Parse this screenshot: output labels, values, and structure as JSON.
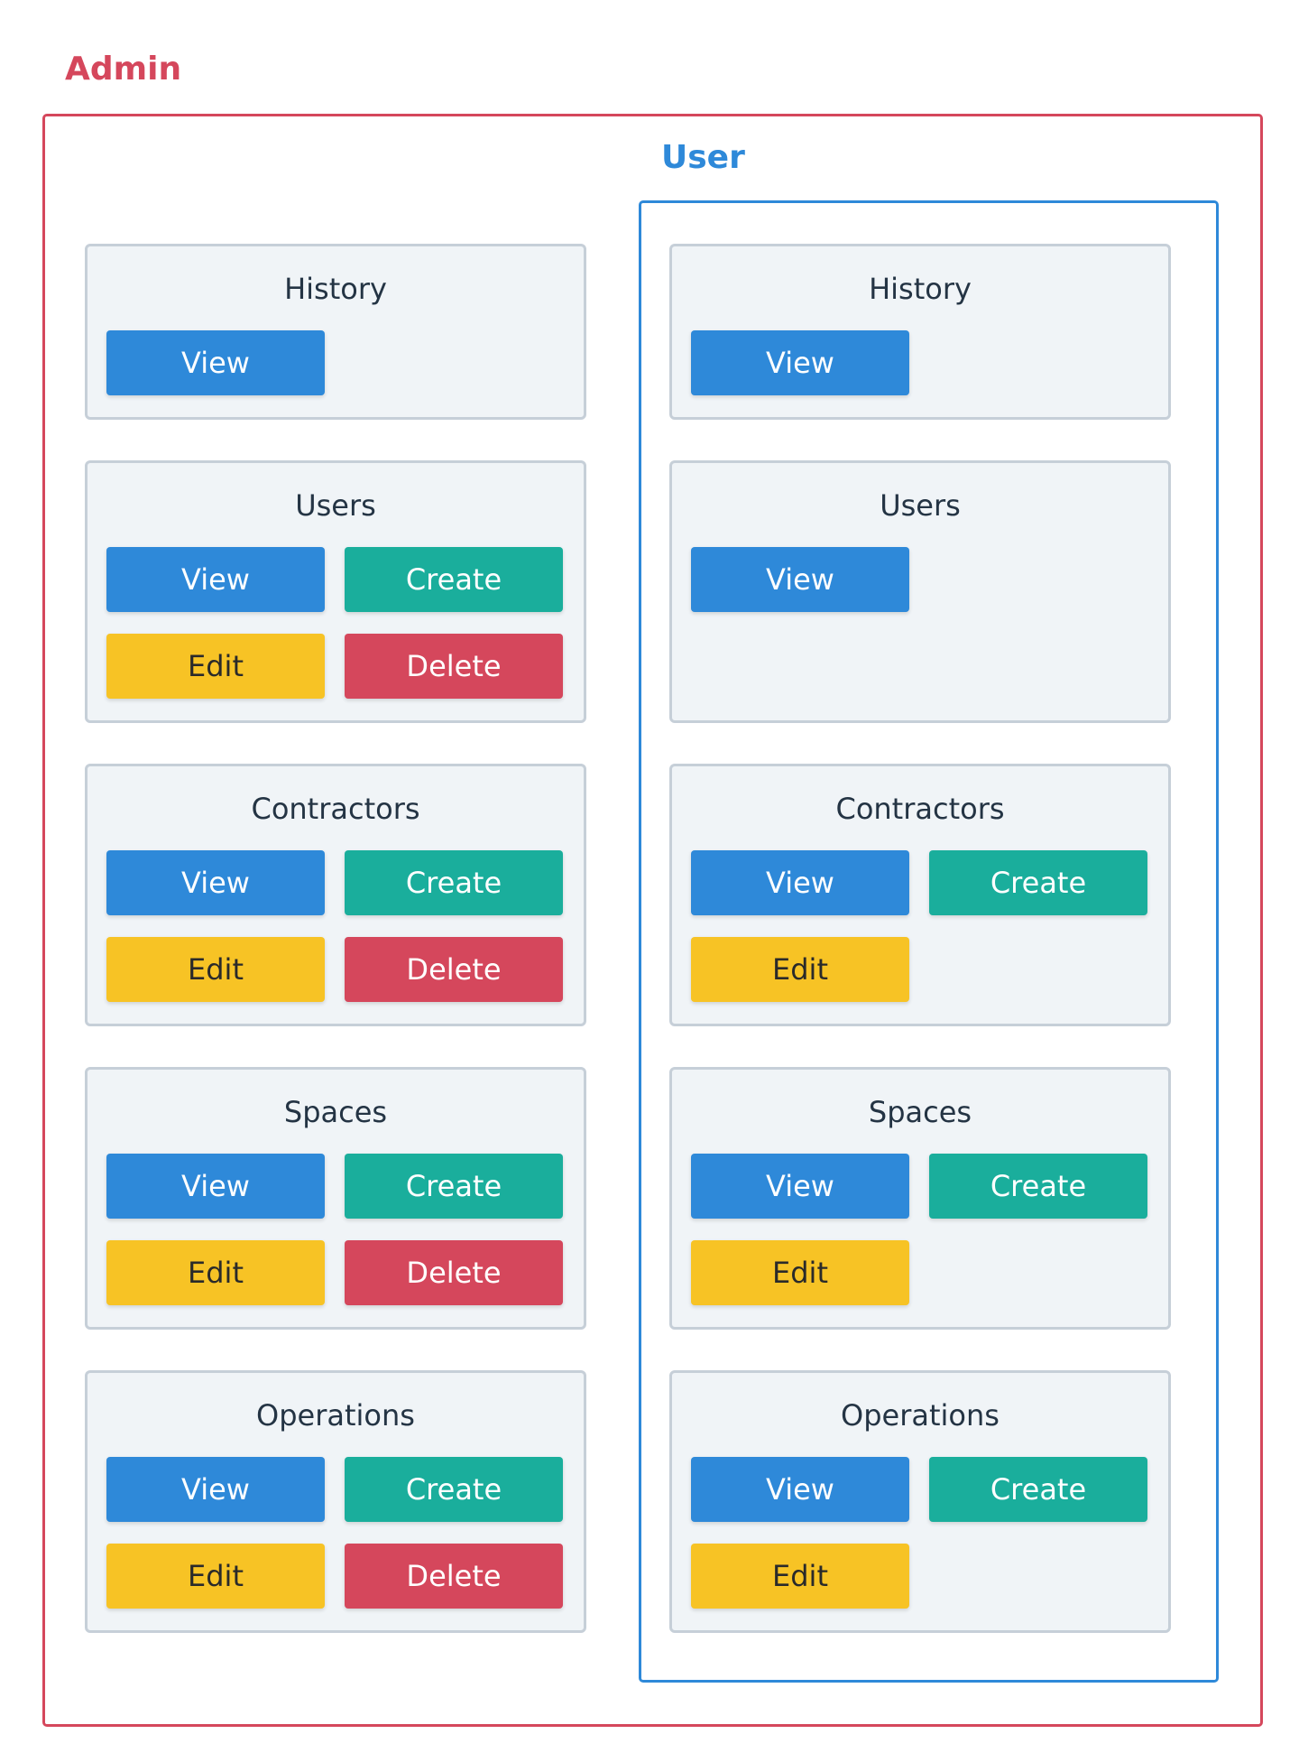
{
  "roles": {
    "admin": {
      "label": "Admin",
      "color": "#d5475c",
      "panels": [
        {
          "title": "History",
          "buttons": [
            "view"
          ]
        },
        {
          "title": "Users",
          "buttons": [
            "view",
            "create",
            "edit",
            "delete"
          ]
        },
        {
          "title": "Contractors",
          "buttons": [
            "view",
            "create",
            "edit",
            "delete"
          ]
        },
        {
          "title": "Spaces",
          "buttons": [
            "view",
            "create",
            "edit",
            "delete"
          ]
        },
        {
          "title": "Operations",
          "buttons": [
            "view",
            "create",
            "edit",
            "delete"
          ]
        }
      ]
    },
    "user": {
      "label": "User",
      "color": "#2e89d9",
      "panels": [
        {
          "title": "History",
          "buttons": [
            "view"
          ]
        },
        {
          "title": "Users",
          "buttons": [
            "view"
          ]
        },
        {
          "title": "Contractors",
          "buttons": [
            "view",
            "create",
            "edit"
          ]
        },
        {
          "title": "Spaces",
          "buttons": [
            "view",
            "create",
            "edit"
          ]
        },
        {
          "title": "Operations",
          "buttons": [
            "view",
            "create",
            "edit"
          ]
        }
      ]
    }
  },
  "actions": {
    "view": {
      "label": "View",
      "bg": "#2e89d9",
      "fg": "#ffffff"
    },
    "create": {
      "label": "Create",
      "bg": "#1aae9c",
      "fg": "#ffffff"
    },
    "edit": {
      "label": "Edit",
      "bg": "#f7c325",
      "fg": "#2a2a2a"
    },
    "delete": {
      "label": "Delete",
      "bg": "#d5475c",
      "fg": "#ffffff"
    }
  }
}
